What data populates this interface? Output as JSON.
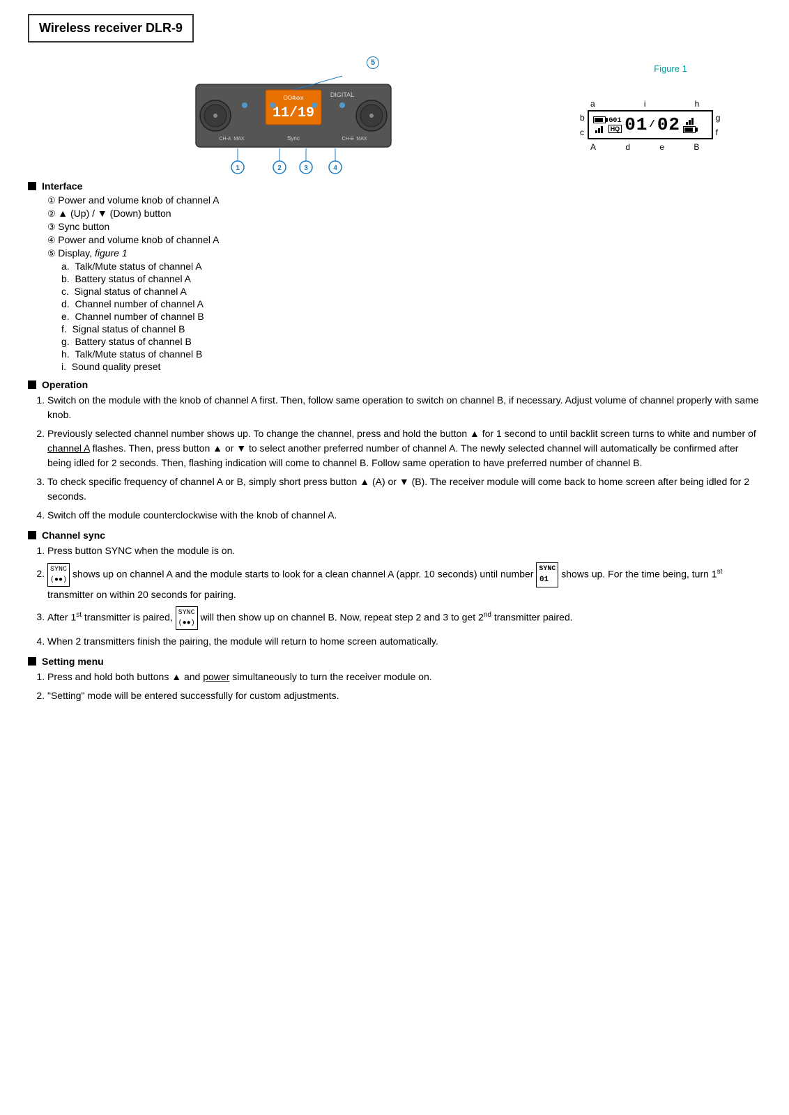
{
  "header": {
    "title": "Wireless receiver DLR-9"
  },
  "figure1": {
    "title": "Figure 1",
    "labels": {
      "a": "a",
      "b": "b",
      "c": "c",
      "d": "d",
      "e": "e",
      "f": "f",
      "g": "g",
      "h": "h",
      "i": "i"
    },
    "channel_a_num": "01",
    "channel_b_num": "02",
    "channel_ab": "A",
    "channel_b_letter": "B"
  },
  "interface": {
    "section_title": "Interface",
    "items": [
      {
        "num": "①",
        "text": "Power and volume knob of channel A"
      },
      {
        "num": "②",
        "text": "▲ (Up) / ▼ (Down) button"
      },
      {
        "num": "③",
        "text": "Sync button"
      },
      {
        "num": "④",
        "text": "Power and volume knob of channel A"
      },
      {
        "num": "⑤",
        "text": "Display, figure 1"
      }
    ],
    "sub_items": [
      {
        "letter": "a.",
        "text": "Talk/Mute status of channel A"
      },
      {
        "letter": "b.",
        "text": "Battery status of channel A"
      },
      {
        "letter": "c.",
        "text": "Signal status of channel A"
      },
      {
        "letter": "d.",
        "text": "Channel number of channel A"
      },
      {
        "letter": "e.",
        "text": "Channel number of channel B"
      },
      {
        "letter": "f.",
        "text": "Signal status of channel B"
      },
      {
        "letter": "g.",
        "text": "Battery status of channel B"
      },
      {
        "letter": "h.",
        "text": "Talk/Mute status of channel B"
      },
      {
        "letter": "i.",
        "text": "Sound quality preset"
      }
    ]
  },
  "operation": {
    "section_title": "Operation",
    "items": [
      "Switch on the module with the knob of channel A first. Then, follow same operation to switch on channel B, if necessary. Adjust volume of channel properly with same knob.",
      "Previously selected channel number shows up. To change the channel, press and hold the button ▲ for 1 second to until backlit screen turns to white and number of channel A flashes. Then, press button ▲ or ▼ to select another preferred number of channel A. The newly selected channel will automatically be confirmed after being idled for 2 seconds. Then, flashing indication will come to channel B. Follow same operation to have preferred number of channel B.",
      "To check specific frequency of channel A or B, simply short press button ▲ (A) or ▼ (B). The receiver module will come back to home screen after being idled for 2 seconds.",
      "Switch off the module counterclockwise with the knob of channel A."
    ]
  },
  "channel_sync": {
    "section_title": "Channel sync",
    "items": [
      "Press button SYNC when the module is on.",
      "shows up on channel A and the module starts to look for a clean channel A (appr. 10 seconds) until number  shows up. For the time being, turn 1st transmitter on within 20 seconds for pairing.",
      "After 1st transmitter is paired,  will then show up on channel B. Now, repeat step 2 and 3 to get 2nd transmitter paired.",
      "When 2 transmitters finish the pairing, the module will return to home screen automatically."
    ],
    "sync_badge_text": "SYNC\n(●●)",
    "sync_badge_num": "SYNC\n 01",
    "sync_badge_b": "SYNC\n(●●)"
  },
  "setting_menu": {
    "section_title": "Setting menu",
    "items": [
      "Press and hold both buttons ▲ and power simultaneously to turn the receiver module on.",
      "\"Setting\" mode will be entered successfully for custom adjustments."
    ]
  }
}
